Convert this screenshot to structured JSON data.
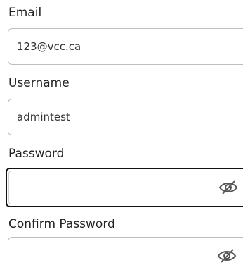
{
  "form": {
    "email": {
      "label": "Email",
      "value": "123@vcc.ca"
    },
    "username": {
      "label": "Username",
      "value": "admintest"
    },
    "password": {
      "label": "Password",
      "value": "",
      "toggle_icon": "eye-slash-icon"
    },
    "confirm_password": {
      "label": "Confirm Password",
      "value": "",
      "toggle_icon": "eye-slash-icon"
    }
  }
}
